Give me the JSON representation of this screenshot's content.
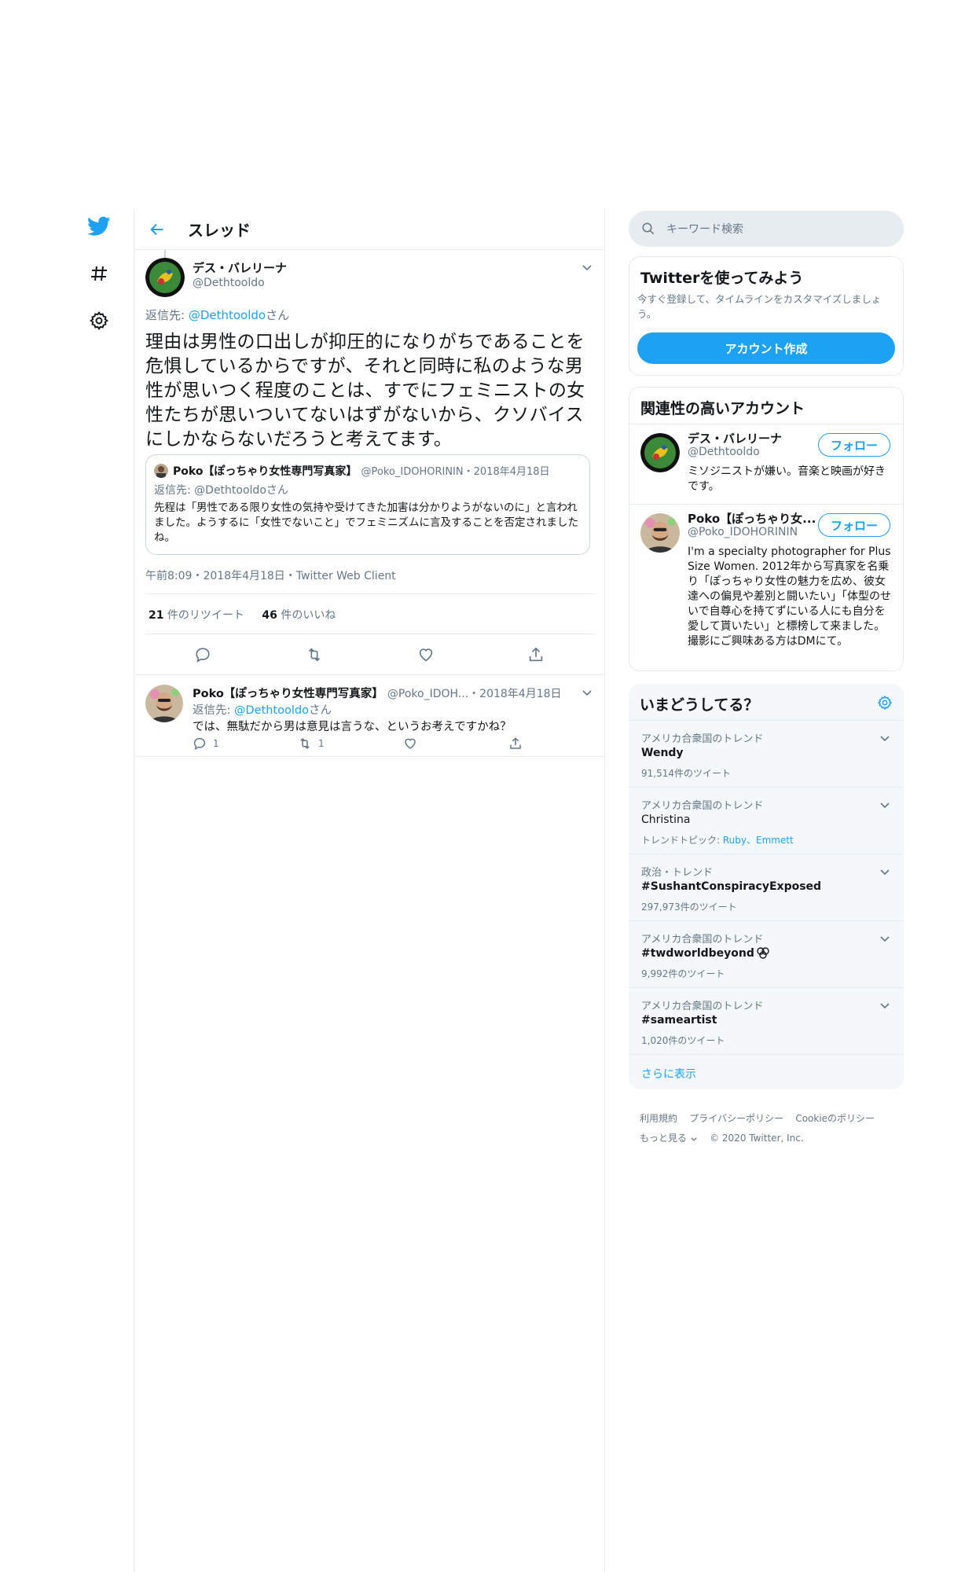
{
  "nav": {
    "twitter_icon": "twitter-bird-icon",
    "explore_icon": "hashtag-icon",
    "settings_icon": "gear-icon"
  },
  "header": {
    "title": "スレッド"
  },
  "main_tweet": {
    "name": "デス・バレリーナ",
    "handle": "@Dethtooldo",
    "reply_prefix": "返信先: ",
    "reply_to": "@Dethtooldo",
    "reply_suffix": "さん",
    "text": "理由は男性の口出しが抑圧的になりがちであることを危惧しているからですが、それと同時に私のような男性が思いつく程度のことは、すでにフェミニストの女性たちが思いついてないはずがないから、クソバイスにしかならないだろうと考えてます。",
    "quote": {
      "name": "Poko【ぽっちゃり女性専門写真家】",
      "handle": "@Poko_IDOHORININ",
      "date": "・2018年4月18日",
      "reply_line": "返信先: @Dethtooldoさん",
      "text": "先程は「男性である限り女性の気持や受けてきた加害は分かりようがないのに」と言われました。ようするに「女性でないこと」でフェミニズムに言及することを否定されましたね。"
    },
    "timestamp": "午前8:09・2018年4月18日・Twitter Web Client",
    "retweets_count": "21",
    "retweets_label": " 件のリツイート",
    "likes_count": "46",
    "likes_label": " 件のいいね"
  },
  "reply_tweet": {
    "name": "Poko【ぽっちゃり女性専門写真家】",
    "handle": "@Poko_IDOH...",
    "date": "・2018年4月18日",
    "reply_prefix": "返信先: ",
    "reply_to": "@Dethtooldo",
    "reply_suffix": "さん",
    "text": "では、無駄だから男は意見は言うな、というお考えですかね？",
    "reply_count": "1",
    "retweet_count": "1"
  },
  "search": {
    "placeholder": "キーワード検索"
  },
  "signup": {
    "title": "Twitterを使ってみよう",
    "desc": "今すぐ登録して、タイムラインをカスタマイズしましょう。",
    "button": "アカウント作成"
  },
  "related": {
    "title": "関連性の高いアカウント",
    "follow_label": "フォロー",
    "accounts": [
      {
        "name": "デス・バレリーナ",
        "handle": "@Dethtooldo",
        "bio": "ミソジニストが嫌い。音楽と映画が好きです。"
      },
      {
        "name": "Poko【ぽっちゃり女...",
        "handle": "@Poko_IDOHORININ",
        "bio": "I'm a specialty photographer for Plus Size Women. 2012年から写真家を名乗り「ぽっちゃり女性の魅力を広め、彼女達への偏見や差別と闘いたい」「体型のせいで自尊心を持てずにいる人にも自分を愛して貰いたい」と標榜して来ました。 撮影にご興味ある方はDMにて。"
      }
    ]
  },
  "trends": {
    "title": "いまどうしてる？",
    "items": [
      {
        "meta": "アメリカ合衆国のトレンド",
        "name": "Wendy",
        "sub": "91,514件のツイート"
      },
      {
        "meta": "アメリカ合衆国のトレンド",
        "name": "Christina",
        "sub_prefix": "トレンドトピック: ",
        "sub_links": "Ruby、Emmett"
      },
      {
        "meta": "政治・トレンド",
        "name": "#SushantConspiracyExposed",
        "sub": "297,973件のツイート"
      },
      {
        "meta": "アメリカ合衆国のトレンド",
        "name": "#twdworldbeyond",
        "sub": "9,992件のツイート"
      },
      {
        "meta": "アメリカ合衆国のトレンド",
        "name": "#sameartist",
        "sub": "1,020件のツイート"
      }
    ],
    "show_more": "さらに表示"
  },
  "footer": {
    "terms": "利用規約",
    "privacy": "プライバシーポリシー",
    "cookie": "Cookieのポリシー",
    "more": "もっと見る",
    "copyright": "© 2020 Twitter, Inc."
  },
  "colors": {
    "accent": "#1da1f2",
    "text": "#14171a",
    "muted": "#657786",
    "border": "#e6ecf0"
  }
}
